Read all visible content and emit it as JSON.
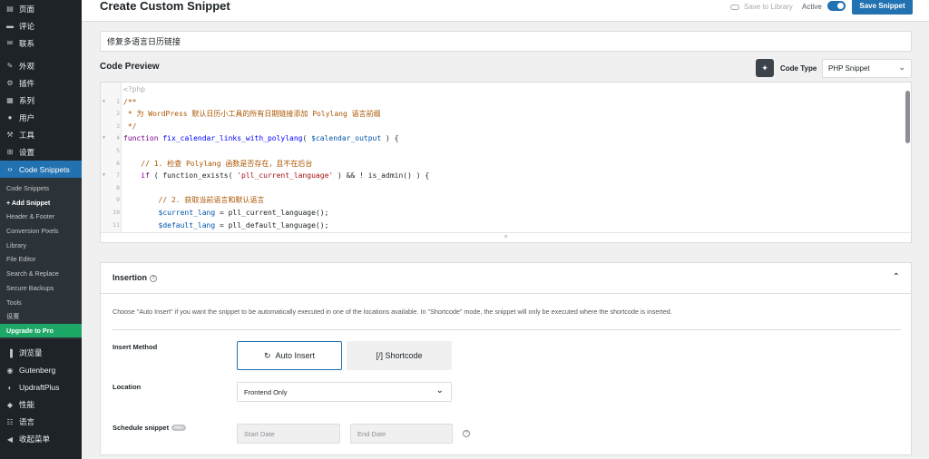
{
  "sidebar": {
    "menu_top": [
      {
        "label": "页面",
        "icon": "pages-icon"
      },
      {
        "label": "评论",
        "icon": "comments-icon"
      },
      {
        "label": "联系",
        "icon": "mail-icon"
      }
    ],
    "menu_mid": [
      {
        "label": "外观",
        "icon": "appearance-icon"
      },
      {
        "label": "插件",
        "icon": "plugins-icon"
      },
      {
        "label": "系列",
        "icon": "series-icon"
      },
      {
        "label": "用户",
        "icon": "users-icon"
      },
      {
        "label": "工具",
        "icon": "tools-icon"
      },
      {
        "label": "设置",
        "icon": "settings-icon"
      }
    ],
    "active_item": {
      "label": "Code Snippets",
      "icon": "code-snippets-icon"
    },
    "submenu": [
      {
        "label": "Code Snippets"
      },
      {
        "label": "+ Add Snippet",
        "current": true
      },
      {
        "label": "Header & Footer"
      },
      {
        "label": "Conversion Pixels"
      },
      {
        "label": "Library"
      },
      {
        "label": "File Editor"
      },
      {
        "label": "Search & Replace"
      },
      {
        "label": "Secure Backups"
      },
      {
        "label": "Tools"
      },
      {
        "label": "设置"
      }
    ],
    "upgrade_label": "Upgrade to Pro",
    "menu_bottom": [
      {
        "label": "浏览量",
        "icon": "stats-icon"
      },
      {
        "label": "Gutenberg",
        "icon": "gutenberg-icon"
      },
      {
        "label": "UpdraftPlus",
        "icon": "updraft-icon"
      },
      {
        "label": "性能",
        "icon": "performance-icon"
      },
      {
        "label": "语言",
        "icon": "language-icon"
      },
      {
        "label": "收起菜单",
        "icon": "collapse-menu-icon"
      }
    ]
  },
  "header": {
    "title": "Create Custom Snippet",
    "save_to_library": "Save to Library",
    "active_label": "Active",
    "active_toggle_on": true,
    "save_button": "Save Snippet"
  },
  "snippet": {
    "title_value": "修复多语言日历链接"
  },
  "code_preview": {
    "heading": "Code Preview",
    "code_type_label": "Code Type",
    "code_type_value": "PHP Snippet",
    "lines": [
      {
        "n": "",
        "fold": false,
        "tokens": [
          {
            "t": "<?php",
            "c": "tag"
          }
        ]
      },
      {
        "n": "1",
        "fold": true,
        "tokens": [
          {
            "t": "/**",
            "c": "comment"
          }
        ]
      },
      {
        "n": "2",
        "fold": false,
        "tokens": [
          {
            "t": " * 为 WordPress 默认日历小工具的所有日期链接添加 Polylang 语言前缀",
            "c": "comment"
          }
        ]
      },
      {
        "n": "3",
        "fold": false,
        "tokens": [
          {
            "t": " */",
            "c": "comment"
          }
        ]
      },
      {
        "n": "4",
        "fold": true,
        "tokens": [
          {
            "t": "function ",
            "c": "kw"
          },
          {
            "t": "fix_calendar_links_with_polylang",
            "c": "def"
          },
          {
            "t": "( ",
            "c": "plain"
          },
          {
            "t": "$calendar_output",
            "c": "var"
          },
          {
            "t": " ) {",
            "c": "plain"
          }
        ]
      },
      {
        "n": "5",
        "fold": false,
        "tokens": []
      },
      {
        "n": "6",
        "fold": false,
        "tokens": [
          {
            "t": "    // 1. 检查 Polylang 函数是否存在，且不在后台",
            "c": "comment"
          }
        ]
      },
      {
        "n": "7",
        "fold": true,
        "tokens": [
          {
            "t": "    if",
            "c": "kw"
          },
          {
            "t": " ( function_exists( ",
            "c": "plain"
          },
          {
            "t": "'pll_current_language'",
            "c": "str"
          },
          {
            "t": " ) && ! is_admin() ) {",
            "c": "plain"
          }
        ]
      },
      {
        "n": "8",
        "fold": false,
        "tokens": []
      },
      {
        "n": "9",
        "fold": false,
        "tokens": [
          {
            "t": "        // 2. 获取当前语言和默认语言",
            "c": "comment"
          }
        ]
      },
      {
        "n": "10",
        "fold": false,
        "tokens": [
          {
            "t": "        $current_lang",
            "c": "var"
          },
          {
            "t": " = pll_current_language();",
            "c": "plain"
          }
        ]
      },
      {
        "n": "11",
        "fold": false,
        "tokens": [
          {
            "t": "        $default_lang",
            "c": "var"
          },
          {
            "t": " = pll_default_language();",
            "c": "plain"
          }
        ]
      }
    ]
  },
  "insertion": {
    "title": "Insertion",
    "description": "Choose \"Auto Insert\" if you want the snippet to be automatically executed in one of the locations available. In \"Shortcode\" mode, the snippet will only be executed where the shortcode is inserted.",
    "insert_method_label": "Insert Method",
    "auto_insert_label": "Auto Insert",
    "shortcode_label": "[/] Shortcode",
    "location_label": "Location",
    "location_value": "Frontend Only",
    "schedule_label": "Schedule snippet",
    "pro_badge": "PRO",
    "start_date_placeholder": "Start Date",
    "end_date_placeholder": "End Date"
  }
}
